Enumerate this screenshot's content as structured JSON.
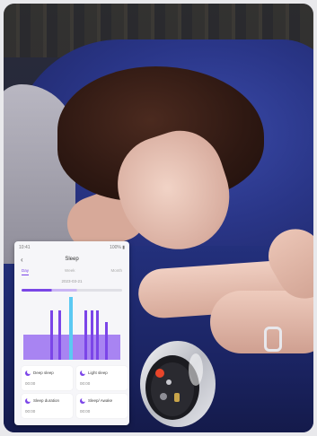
{
  "photo": {
    "subject_icon": "sleeping-woman-photo",
    "product_icon": "smart-ring"
  },
  "phone": {
    "status_time": "10:41",
    "status_right": "100% ▮",
    "back_glyph": "‹",
    "title": "Sleep",
    "tabs": [
      {
        "label": "Day",
        "active": true
      },
      {
        "label": "Week",
        "active": false
      },
      {
        "label": "Month",
        "active": false
      }
    ],
    "date": "2023-03-21",
    "chart": {
      "type": "bar",
      "colors": {
        "deep": "#7b45e8",
        "light": "#a884f2",
        "awake": "#5bc9f2"
      }
    },
    "cards": [
      {
        "label": "Deep sleep",
        "value": "00:00"
      },
      {
        "label": "Light sleep",
        "value": "00:00"
      },
      {
        "label": "Sleep duration",
        "value": "00:00"
      },
      {
        "label": "Sleep/ Awake",
        "value": "00:00"
      }
    ]
  }
}
